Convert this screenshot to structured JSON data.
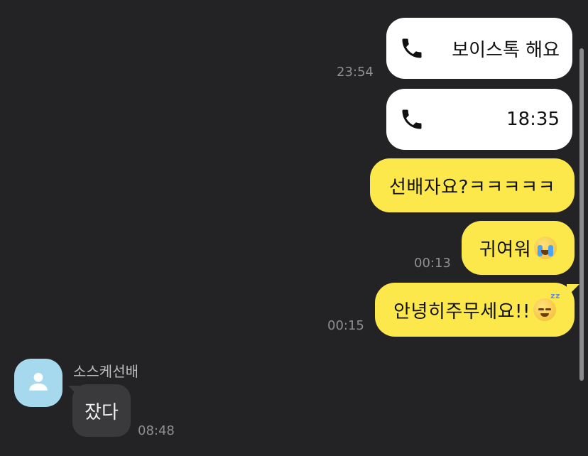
{
  "chat": {
    "messages": [
      {
        "type": "voice_call",
        "text": "보이스톡 해요",
        "time": "23:54",
        "side": "right",
        "icon": "phone-icon"
      },
      {
        "type": "voice_call",
        "text": "18:35",
        "time": "",
        "side": "right",
        "icon": "phone-icon"
      },
      {
        "type": "text",
        "text": "선배자요?ㅋㅋㅋㅋㅋ",
        "time": "",
        "side": "right"
      },
      {
        "type": "text",
        "text": "귀여워",
        "emoji": "loudly-crying-face-emoji",
        "time": "00:13",
        "side": "right"
      },
      {
        "type": "text",
        "text": "안녕히주무세요!!",
        "emoji": "sleeping-face-emoji",
        "time": "00:15",
        "side": "right"
      },
      {
        "type": "text",
        "text": "잤다",
        "time": "08:48",
        "side": "left",
        "sender": "소스케선배"
      }
    ],
    "sender": {
      "name": "소스케선배",
      "avatar_icon": "person-icon",
      "avatar_color": "#a6d9ee"
    }
  },
  "colors": {
    "background": "#232325",
    "my_bubble": "#fde84b",
    "call_bubble": "#ffffff",
    "their_bubble": "#3a3a3c",
    "timestamp": "#8e8e93"
  }
}
